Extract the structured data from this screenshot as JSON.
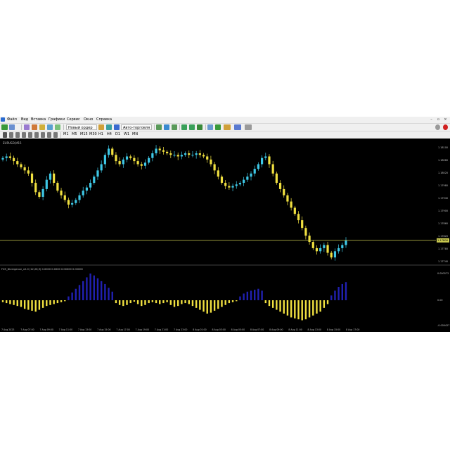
{
  "window": {
    "menu": [
      "Файл",
      "Вид",
      "Вставка",
      "Графики",
      "Сервис",
      "Окно",
      "Справка"
    ]
  },
  "toolbar": {
    "new_order_label": "Новый ордер",
    "autotrading_label": "Авто-торговля",
    "timeframes": [
      "M1",
      "M5",
      "M15",
      "M30",
      "H1",
      "H4",
      "D1",
      "W1",
      "MN"
    ]
  },
  "chart": {
    "symbol_label": "EURUSD,M15",
    "price_labels": [
      "1.18100",
      "1.18060",
      "1.18020",
      "1.17980",
      "1.17940",
      "1.17900",
      "1.17860",
      "1.17820",
      "1.17780",
      "1.17740"
    ],
    "current_price_label": "1.17806",
    "indicator_label": "FX5_Divergence_v2.0 (12,26,9) 0.0000 0.0000 0.00000 0.00000",
    "indicator_scale": [
      "0.000573",
      "0.00",
      "-0.000427"
    ],
    "time_labels": [
      "7 Aug 2023",
      "7 Aug 07:00",
      "7 Aug 09:00",
      "7 Aug 11:00",
      "7 Aug 13:00",
      "7 Aug 15:00",
      "7 Aug 17:00",
      "7 Aug 19:00",
      "7 Aug 21:00",
      "7 Aug 23:00",
      "8 Aug 01:00",
      "8 Aug 03:00",
      "8 Aug 05:00",
      "8 Aug 07:00",
      "8 Aug 09:00",
      "8 Aug 11:00",
      "8 Aug 13:00",
      "8 Aug 15:00",
      "8 Aug 17:00"
    ],
    "colors": {
      "background": "#000000",
      "bull_candle": "#3ec8e6",
      "bear_candle": "#f0e040",
      "bid_line": "#c8c850",
      "hist_up": "#2020b0",
      "hist_down": "#f0e040",
      "grid_text": "#c0c0c0",
      "divergence_line": "#50a050"
    }
  },
  "chart_data": {
    "type": "bar",
    "closes": [
      1.1808,
      1.18085,
      1.1808,
      1.1807,
      1.1806,
      1.1805,
      1.1804,
      1.1803,
      1.18,
      1.1797,
      1.17955,
      1.1798,
      1.1801,
      1.1803,
      1.18,
      1.17975,
      1.1796,
      1.17945,
      1.1793,
      1.17935,
      1.17945,
      1.1796,
      1.17975,
      1.17985,
      1.18,
      1.1802,
      1.1804,
      1.1806,
      1.1809,
      1.1811,
      1.1809,
      1.1807,
      1.1806,
      1.18075,
      1.18085,
      1.1808,
      1.1807,
      1.1806,
      1.18055,
      1.18065,
      1.1808,
      1.18095,
      1.1811,
      1.18105,
      1.181,
      1.18095,
      1.1809,
      1.1809,
      1.18085,
      1.1809,
      1.18095,
      1.1809,
      1.1809,
      1.18095,
      1.1809,
      1.18085,
      1.18075,
      1.1806,
      1.1804,
      1.1802,
      1.18,
      1.1799,
      1.17985,
      1.1799,
      1.17995,
      1.18,
      1.1801,
      1.1802,
      1.1803,
      1.18045,
      1.1806,
      1.1808,
      1.18085,
      1.1806,
      1.1803,
      1.18,
      1.1798,
      1.1796,
      1.1794,
      1.1792,
      1.179,
      1.1788,
      1.17855,
      1.1783,
      1.1781,
      1.1779,
      1.1778,
      1.1779,
      1.178,
      1.17775,
      1.1776,
      1.1778,
      1.1779,
      1.178,
      1.17815
    ],
    "histogram": [
      -4e-05,
      -6e-05,
      -8e-05,
      -0.0001,
      -0.00012,
      -0.00014,
      -0.00018,
      -0.0002,
      -0.00022,
      -0.00024,
      -0.0002,
      -0.00016,
      -0.00012,
      -0.0001,
      -8e-05,
      -6e-05,
      -4e-05,
      -2e-05,
      8e-05,
      0.00016,
      0.00024,
      0.00032,
      0.0004,
      0.00048,
      0.00056,
      0.00052,
      0.00046,
      0.0004,
      0.00034,
      0.00026,
      0.00018,
      -6e-05,
      -0.0001,
      -0.00012,
      -0.0001,
      -6e-05,
      -3e-05,
      -8e-05,
      -0.00012,
      -0.0001,
      -6e-05,
      -4e-05,
      -6e-05,
      -8e-05,
      -6e-05,
      -4e-05,
      -0.0001,
      -0.00014,
      -0.00012,
      -8e-05,
      -6e-05,
      -8e-05,
      -0.00012,
      -0.00016,
      -0.0002,
      -0.00024,
      -0.00028,
      -0.00026,
      -0.00022,
      -0.00018,
      -0.00014,
      -0.0001,
      -6e-05,
      -4e-05,
      -2e-05,
      8e-05,
      0.00014,
      0.00018,
      0.0002,
      0.00022,
      0.00024,
      0.0002,
      -6e-05,
      -0.00012,
      -0.00016,
      -0.0002,
      -0.00024,
      -0.00028,
      -0.00032,
      -0.00036,
      -0.00038,
      -0.0004,
      -0.00042,
      -0.0004,
      -0.00036,
      -0.00032,
      -0.00028,
      -0.00024,
      -0.00016,
      -8e-05,
      0.0001,
      0.0002,
      0.00028,
      0.00034,
      0.00038
    ],
    "ylim": [
      1.1774,
      1.1812
    ]
  }
}
